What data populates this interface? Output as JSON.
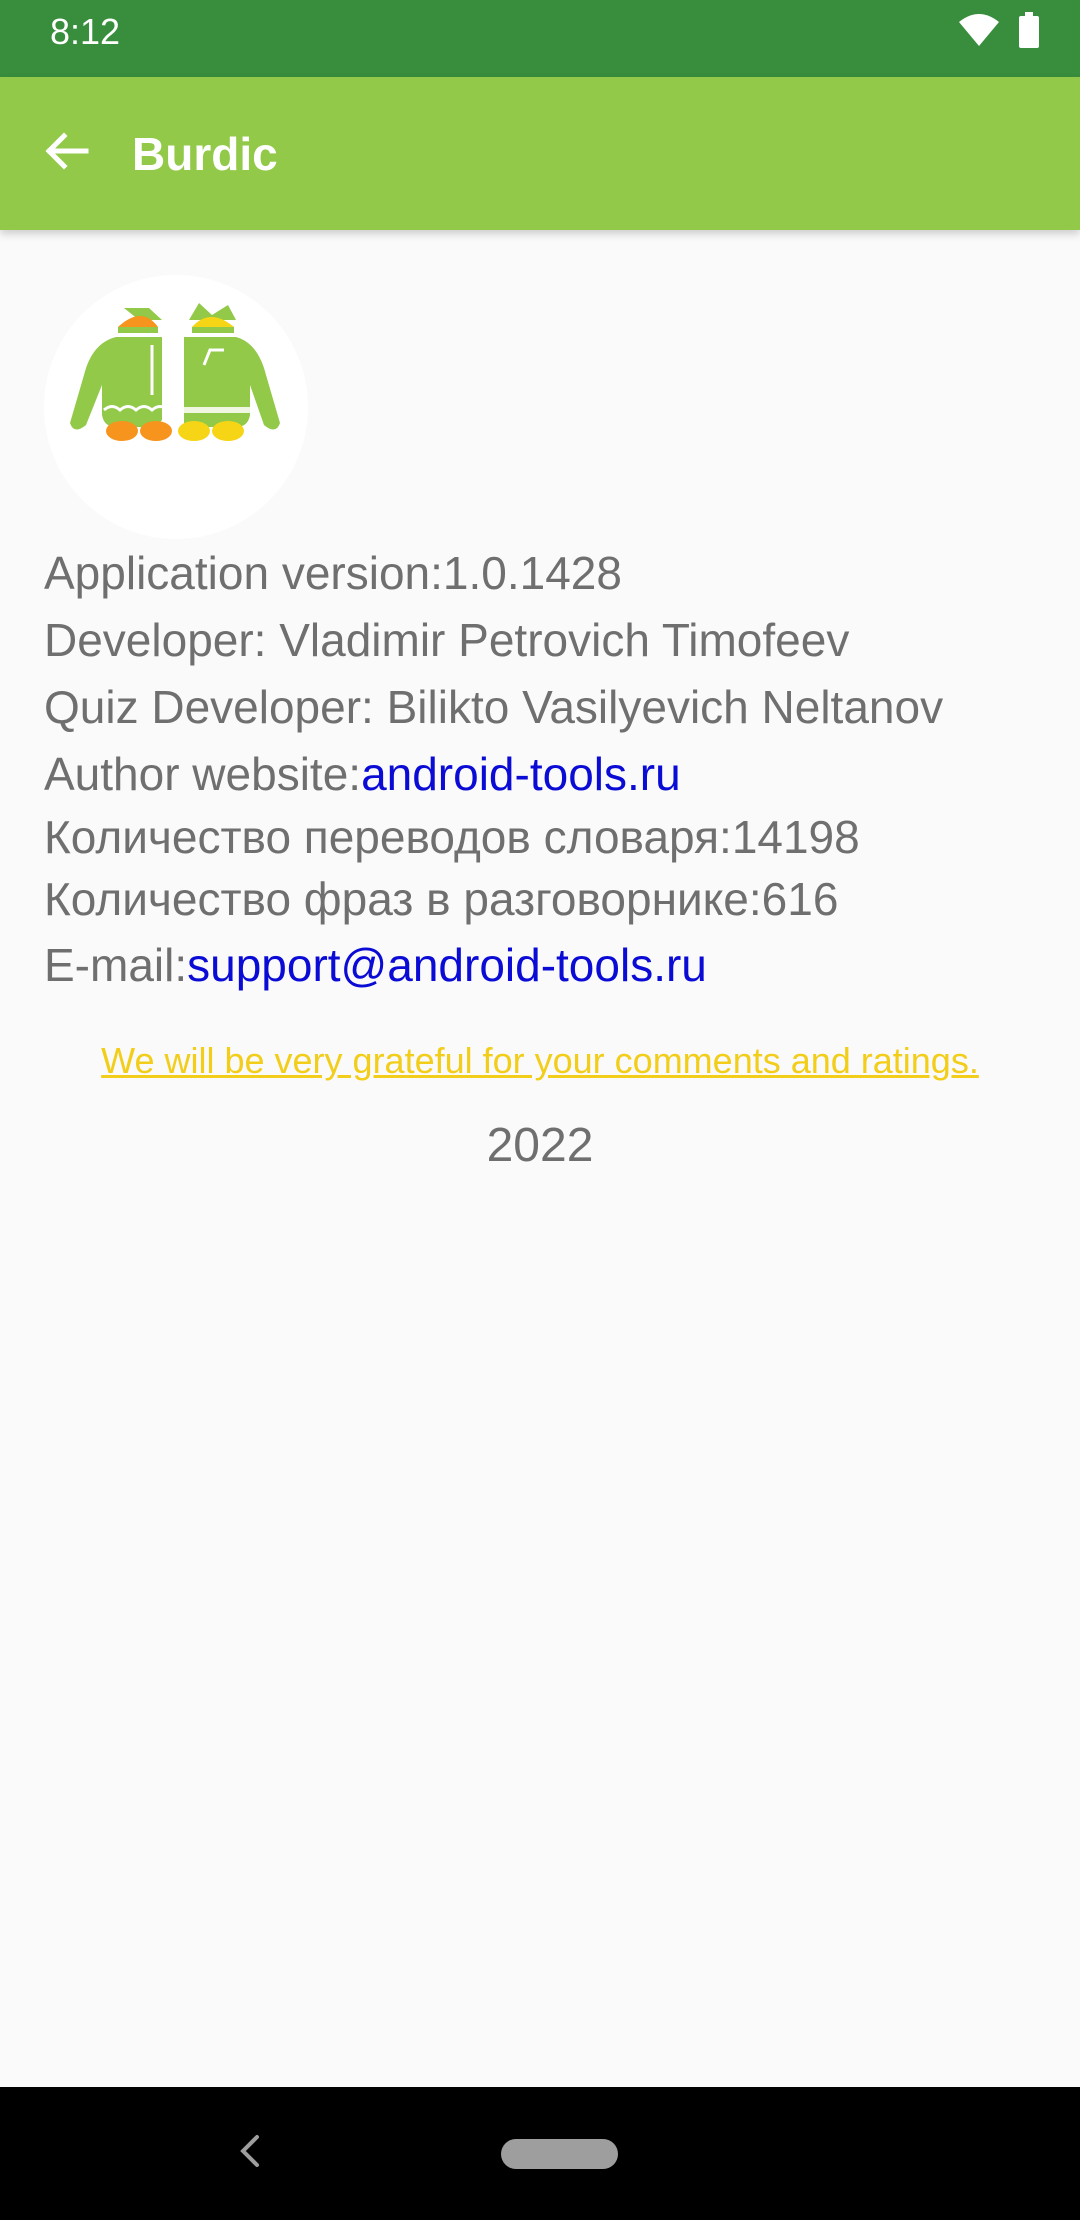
{
  "status_bar": {
    "time": "8:12",
    "icons": [
      "wifi-icon",
      "battery-icon"
    ]
  },
  "app_bar": {
    "title": "Burdic",
    "back_icon": "arrow-back-icon"
  },
  "info": {
    "version_label": "Application version:",
    "version_value": "1.0.1428",
    "developer": "Developer: Vladimir Petrovich Timofeev",
    "quiz_developer": "Quiz Developer: Bilikto Vasilyevich Neltanov",
    "website_label": "Author website:",
    "website_link": "android-tools.ru",
    "translations_label": "Количество переводов словаря:",
    "translations_value": "14198",
    "phrases_label": "Количество фраз в разговорнике:",
    "phrases_value": "616",
    "email_label": "E-mail:",
    "email_link": "support@android-tools.ru"
  },
  "rating_link": "We will be very grateful for your comments and ratings.",
  "year": "2022",
  "colors": {
    "status_bar": "#388e3c",
    "app_bar": "#92c948",
    "link": "#0b0bd6",
    "rating_link": "#f2cd1a",
    "text": "#6f6f6f"
  },
  "nav_bar": {
    "icons": [
      "nav-back-icon",
      "nav-home-pill"
    ]
  }
}
